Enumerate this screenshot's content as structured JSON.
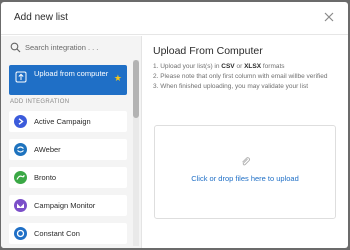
{
  "dialog": {
    "title": "Add new list",
    "close_icon": "close-icon"
  },
  "sidebar": {
    "search_placeholder": "Search integration . . .",
    "upload_item": {
      "label": "Upload from computer",
      "icon": "upload-icon",
      "star_icon": "star-icon",
      "star": "★"
    },
    "section_label": "ADD INTEGRATION",
    "items": [
      {
        "label": "Active Campaign",
        "icon": "active-campaign-icon",
        "color": "#3b5bdb"
      },
      {
        "label": "AWeber",
        "icon": "aweber-icon",
        "color": "#1e73be"
      },
      {
        "label": "Bronto",
        "icon": "bronto-icon",
        "color": "#3aa845"
      },
      {
        "label": "Campaign Monitor",
        "icon": "campaign-monitor-icon",
        "color": "#7b4fc9"
      },
      {
        "label": "Constant Con",
        "icon": "constant-contact-icon",
        "color": "#1f6fc6"
      }
    ]
  },
  "main": {
    "title": "Upload From Computer",
    "step1_pre": "1. Upload your list(s) in ",
    "step1_csv": "CSV",
    "step1_or": " or ",
    "step1_xlsx": "XLSX",
    "step1_post": " formats",
    "step2": "2. Please note that only first column with email willbe verified",
    "step3": "3. When finished uploading, you may validate your list",
    "dropzone_text": "Click or drop files here to upload",
    "dropzone_icon": "paperclip-icon"
  },
  "colors": {
    "accent": "#1f6fc6",
    "star": "#f5c518",
    "backdrop": "#6b6b6b"
  }
}
